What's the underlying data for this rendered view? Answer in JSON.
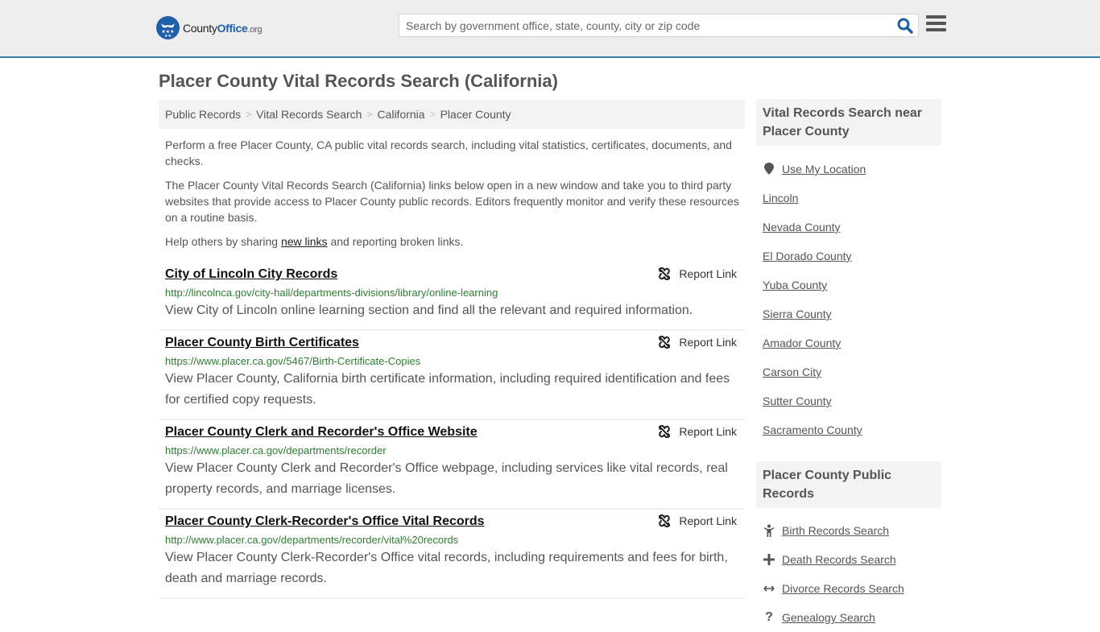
{
  "header": {
    "logo": {
      "part1": "County",
      "part2": "Office",
      "part3": ".org"
    },
    "search_placeholder": "Search by government office, state, county, city or zip code",
    "search_icon": "search-icon",
    "menu_icon": "hamburger-menu-icon"
  },
  "page_title": "Placer County Vital Records Search (California)",
  "breadcrumb": [
    "Public Records",
    "Vital Records Search",
    "California",
    "Placer County"
  ],
  "intro": {
    "p1": "Perform a free Placer County, CA public vital records search, including vital statistics, certificates, documents, and checks.",
    "p2": "The Placer County Vital Records Search (California) links below open in a new window and take you to third party websites that provide access to Placer County public records. Editors frequently monitor and verify these resources on a routine basis.",
    "p3_before": "Help others by sharing ",
    "p3_link": "new links",
    "p3_after": " and reporting broken links."
  },
  "report_label": "Report Link",
  "results": [
    {
      "title": "City of Lincoln City Records",
      "url": "http://lincolnca.gov/city-hall/departments-divisions/library/online-learning",
      "desc": "View City of Lincoln online learning section and find all the relevant and required information."
    },
    {
      "title": "Placer County Birth Certificates",
      "url": "https://www.placer.ca.gov/5467/Birth-Certificate-Copies",
      "desc": "View Placer County, California birth certificate information, including required identification and fees for certified copy requests."
    },
    {
      "title": "Placer County Clerk and Recorder's Office Website",
      "url": "https://www.placer.ca.gov/departments/recorder",
      "desc": "View Placer County Clerk and Recorder's Office webpage, including services like vital records, real property records, and marriage licenses."
    },
    {
      "title": "Placer County Clerk-Recorder's Office Vital Records",
      "url": "http://www.placer.ca.gov/departments/recorder/vital%20records",
      "desc": "View Placer County Clerk-Recorder's Office vital records, including requirements and fees for birth, death and marriage records."
    }
  ],
  "sidebar": {
    "nearby_title": "Vital Records Search near Placer County",
    "use_location": "Use My Location",
    "nearby": [
      "Lincoln",
      "Nevada County",
      "El Dorado County",
      "Yuba County",
      "Sierra County",
      "Amador County",
      "Carson City",
      "Sutter County",
      "Sacramento County"
    ],
    "public_title": "Placer County Public Records",
    "public": [
      {
        "icon": "child-icon",
        "label": "Birth Records Search"
      },
      {
        "icon": "plus-icon",
        "label": "Death Records Search"
      },
      {
        "icon": "arrows-horizontal-icon",
        "label": "Divorce Records Search"
      },
      {
        "icon": "question-icon",
        "label": "Genealogy Search"
      }
    ]
  }
}
